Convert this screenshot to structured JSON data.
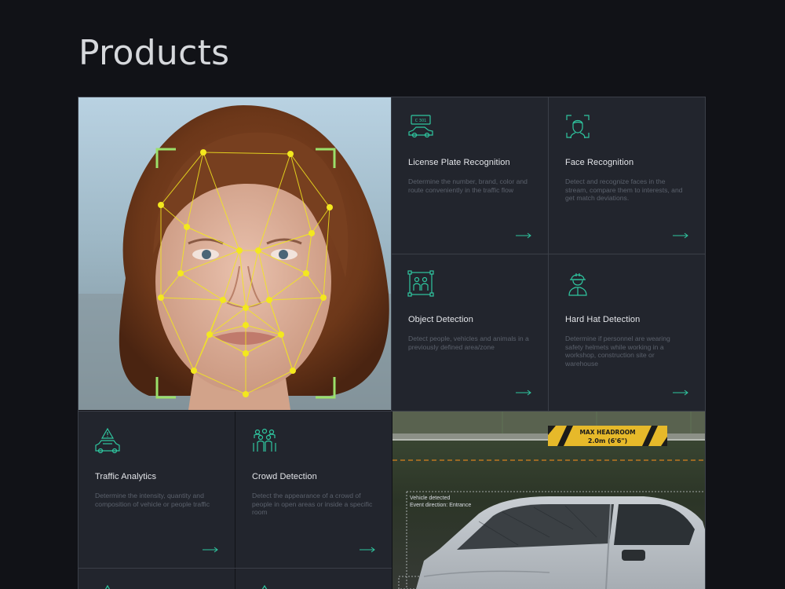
{
  "page": {
    "title": "Products"
  },
  "products": [
    {
      "id": "license-plate-recognition",
      "icon": "car-license-plate-icon",
      "title": "License Plate Recognition",
      "description": "Determine the number, brand, color and route conveniently in the traffic flow"
    },
    {
      "id": "face-recognition",
      "icon": "face-scan-icon",
      "title": "Face Recognition",
      "description": "Detect and recognize faces in the stream, compare them to interests, and get match deviations."
    },
    {
      "id": "object-detection",
      "icon": "object-detection-icon",
      "title": "Object Detection",
      "description": "Detect people, vehicles and animals in a previously defined area/zone"
    },
    {
      "id": "hard-hat-detection",
      "icon": "hard-hat-worker-icon",
      "title": "Hard Hat Detection",
      "description": "Determine if personnel are wearing safety helmets while working in a workshop, construction site or warehouse"
    },
    {
      "id": "traffic-analytics",
      "icon": "traffic-warning-icon",
      "title": "Traffic Analytics",
      "description": "Determine the intensity, quantity and composition of vehicle or people traffic"
    },
    {
      "id": "crowd-detection",
      "icon": "crowd-icon",
      "title": "Crowd Detection",
      "description": "Detect the appearance of a crowd of people in open areas or inside a specific room"
    }
  ],
  "car_photo": {
    "sign_line1": "MAX HEADROOM",
    "sign_line2": "2.0m (6'6\")",
    "overlay_line1": "Vehicle detected",
    "overlay_line2": "Event direction: Entrance"
  },
  "colors": {
    "accent": "#2fc7a0",
    "card_bg": "#22252d",
    "page_bg": "#111217",
    "landmark": "#f3e81e",
    "corner_bracket": "#9be06a"
  }
}
